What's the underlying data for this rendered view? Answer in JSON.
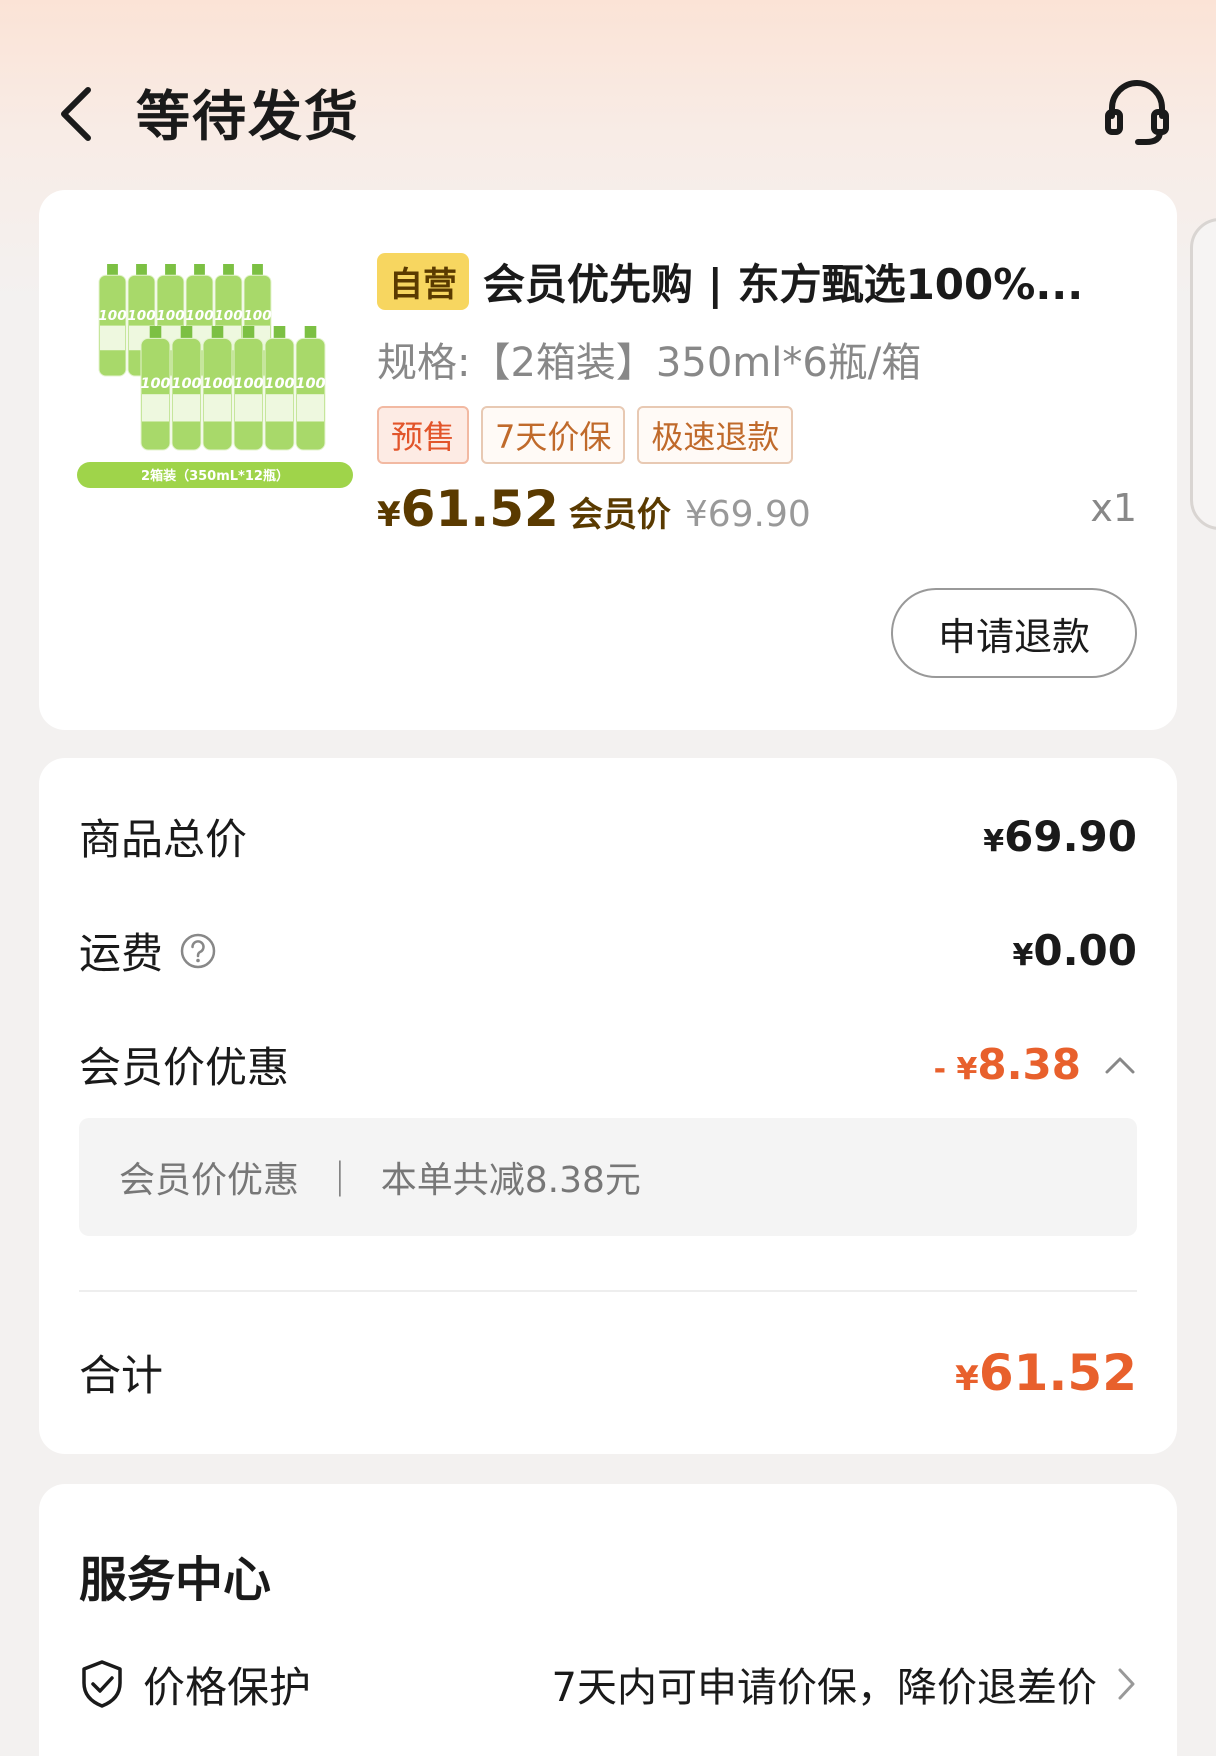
{
  "header": {
    "title": "等待发货"
  },
  "product": {
    "badge": "自营",
    "name": "会员优先购 | 东方甄选100%...",
    "spec": "规格:【2箱装】350ml*6瓶/箱",
    "tags": [
      "预售",
      "7天价保",
      "极速退款"
    ],
    "image_caption": "2箱装（350mL*12瓶）",
    "image_bottle_text": "100",
    "price_yen": "¥",
    "price": "61.52",
    "member_label": "会员价",
    "original_price": "¥69.90",
    "quantity": "x1",
    "refund_button": "申请退款"
  },
  "price_summary": {
    "goods_total_label": "商品总价",
    "goods_total_yen": "¥",
    "goods_total": "69.90",
    "shipping_label": "运费",
    "shipping_yen": "¥",
    "shipping": "0.00",
    "member_discount_label": "会员价优惠",
    "member_discount_prefix": "- ¥",
    "member_discount": "8.38",
    "discount_detail": "会员价优惠  ｜  本单共减8.38元",
    "total_label": "合计",
    "total_yen": "¥",
    "total": "61.52"
  },
  "service_center": {
    "title": "服务中心",
    "items": [
      {
        "name": "价格保护",
        "desc": "7天内可申请价保，降价退差价",
        "icon": "shield-check-icon"
      }
    ]
  },
  "colors": {
    "accent_orange": "#e8602c",
    "member_brown": "#5a3a00",
    "badge_yellow": "#f7d660"
  }
}
